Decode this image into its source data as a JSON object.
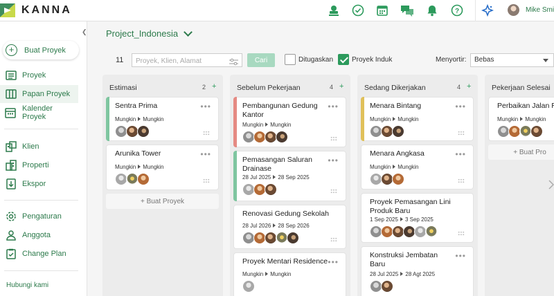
{
  "app": {
    "logo_text": "KANNA",
    "user_name": "Mike Smit",
    "colors": {
      "brand": "#2c7a4b",
      "accent": "#2c9a5c"
    }
  },
  "topbar_icons": [
    "stamp-icon",
    "check-circle-icon",
    "calendar-icon",
    "chat-icon",
    "bell-icon",
    "help-icon",
    "sparkle-icon"
  ],
  "sidebar": {
    "new_project": "Buat Proyek",
    "items": [
      {
        "id": "proyek",
        "label": "Proyek",
        "icon": "list-icon"
      },
      {
        "id": "papan-proyek",
        "label": "Papan Proyek",
        "icon": "board-icon",
        "active": true
      },
      {
        "id": "kalender-proyek",
        "label": "Kalender Proyek",
        "icon": "calendar-icon"
      },
      {
        "id": "klien",
        "label": "Klien",
        "icon": "client-icon"
      },
      {
        "id": "properti",
        "label": "Properti",
        "icon": "property-icon"
      },
      {
        "id": "ekspor",
        "label": "Ekspor",
        "icon": "export-icon"
      },
      {
        "id": "pengaturan",
        "label": "Pengaturan",
        "icon": "gear-icon"
      },
      {
        "id": "anggota",
        "label": "Anggota",
        "icon": "member-icon"
      },
      {
        "id": "change-plan",
        "label": "Change Plan",
        "icon": "plan-icon"
      }
    ],
    "contact": "Hubungi kami"
  },
  "project_selector": {
    "name": "Project_Indonesia"
  },
  "toolbar": {
    "count": "11",
    "search_placeholder": "Proyek, Klien, Alamat",
    "search_button": "Cari",
    "assigned_label": "Ditugaskan",
    "assigned_checked": false,
    "parent_label": "Proyek Induk",
    "parent_checked": true,
    "sort_label": "Menyortir:",
    "sort_value": "Bebas"
  },
  "columns": [
    {
      "title": "Estimasi",
      "count": "2",
      "add": "+",
      "cards": [
        {
          "title": "Sentra Prima",
          "meta_a": "Mungkin",
          "meta_b": "Mungkin"
        },
        {
          "title": "Arunika Tower",
          "meta_a": "Mungkin",
          "meta_b": "Mungkin"
        }
      ],
      "add_label": "+ Buat Proyek"
    },
    {
      "title": "Sebelum Pekerjaan",
      "count": "4",
      "add": "+",
      "cards": [
        {
          "title": "Pembangunan Gedung Kantor",
          "meta_a": "Mungkin",
          "meta_b": "Mungkin"
        },
        {
          "title": "Pemasangan Saluran Drainase",
          "meta_a": "28 Jul 2025",
          "meta_b": "28 Sep 2025"
        },
        {
          "title": "Renovasi Gedung Sekolah",
          "meta_a": "28 Jul 2026",
          "meta_b": "28 Sep 2026"
        },
        {
          "title": "Proyek Mentari Residence",
          "meta_a": "Mungkin",
          "meta_b": "Mungkin"
        }
      ]
    },
    {
      "title": "Sedang Dikerjakan",
      "count": "4",
      "add": "+",
      "cards": [
        {
          "title": "Menara Bintang",
          "meta_a": "Mungkin",
          "meta_b": "Mungkin"
        },
        {
          "title": "Menara Angkasa",
          "meta_a": "Mungkin",
          "meta_b": "Mungkin"
        },
        {
          "title": "Proyek Pemasangan Lini Produk Baru",
          "meta_a": "1 Sep 2025",
          "meta_b": "3 Sep 2025"
        },
        {
          "title": "Konstruksi Jembatan Baru",
          "meta_a": "28 Jul 2025",
          "meta_b": "28 Agt 2025"
        }
      ]
    },
    {
      "title": "Pekerjaan Selesai",
      "count": "",
      "add": "",
      "cards": [
        {
          "title": "Perbaikan Jalan R",
          "meta_a": "Mungkin",
          "meta_b": "Mungkin"
        }
      ],
      "add_label": "+ Buat Pro"
    }
  ]
}
